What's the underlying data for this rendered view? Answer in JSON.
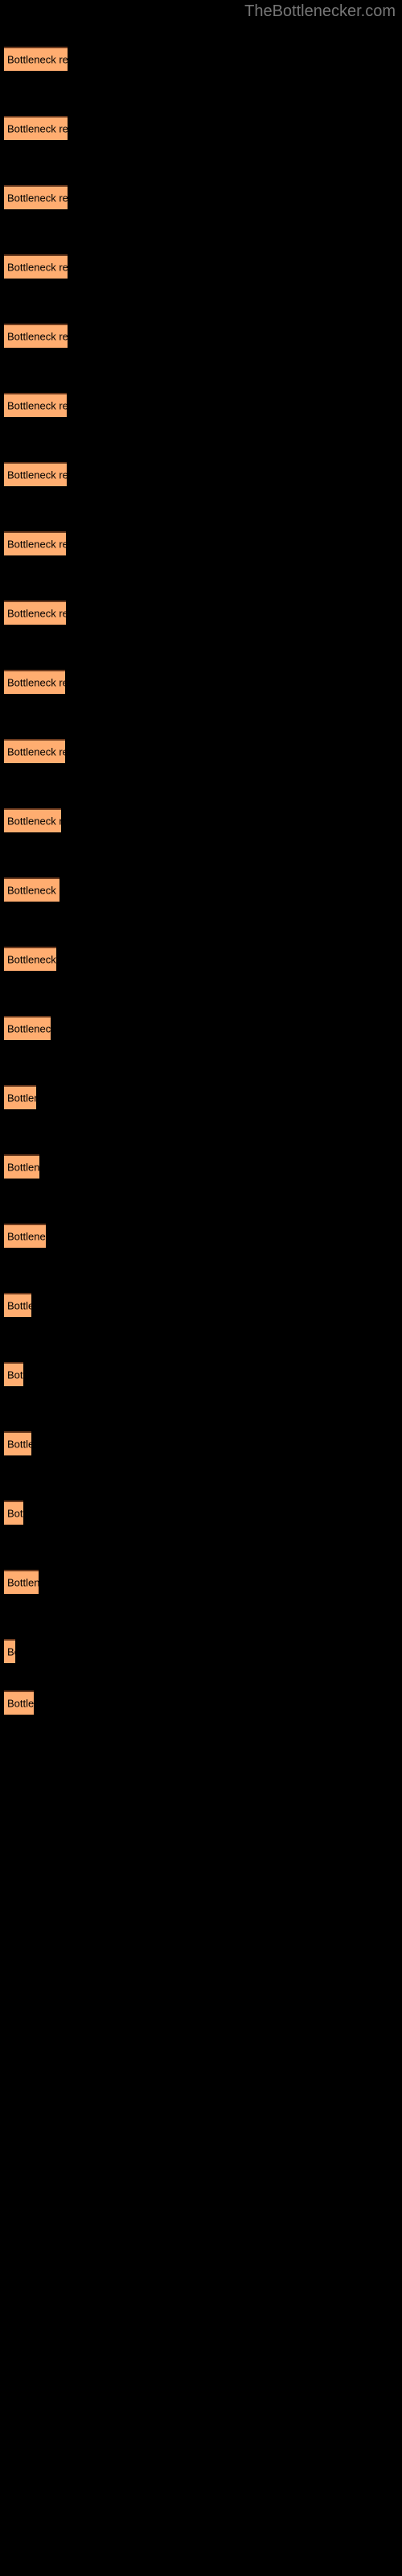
{
  "site": {
    "title": "TheBottlenecker.com",
    "title_color": "#767676"
  },
  "colors": {
    "background": "#000000",
    "bar_fill": "#ffad70",
    "bar_top_border": "#6b3a1e",
    "bar_text": "#000000"
  },
  "chart_data": {
    "type": "bar",
    "orientation": "horizontal",
    "title": "",
    "subtitle": "",
    "xlabel": "",
    "ylabel": "",
    "grid": false,
    "legend": null,
    "bar_label_text": "Bottleneck result",
    "categories": [
      "Bottleneck result",
      "Bottleneck result",
      "Bottleneck result",
      "Bottleneck result",
      "Bottleneck result",
      "Bottleneck result",
      "Bottleneck result",
      "Bottleneck result",
      "Bottleneck result",
      "Bottleneck result",
      "Bottleneck result",
      "Bottleneck result",
      "Bottleneck result",
      "Bottleneck result",
      "Bottleneck result",
      "Bottleneck result",
      "Bottleneck result",
      "Bottleneck result",
      "Bottleneck result",
      "Bottleneck result",
      "Bottleneck result",
      "Bottleneck result",
      "Bottleneck result",
      "Bottleneck result"
    ],
    "values": [
      79,
      79,
      79,
      79,
      79,
      79,
      79,
      79,
      79,
      79,
      79,
      74,
      70,
      66,
      61,
      46,
      45,
      41,
      34,
      28,
      33,
      26,
      44,
      16,
      38
    ],
    "xlim": [
      0,
      500
    ],
    "ylim": null
  },
  "bars": [
    {
      "label": "Bottleneck result",
      "width": 79,
      "top": 58
    },
    {
      "label": "Bottleneck result",
      "width": 79,
      "top": 144
    },
    {
      "label": "Bottleneck result",
      "width": 79,
      "top": 230
    },
    {
      "label": "Bottleneck result",
      "width": 79,
      "top": 316
    },
    {
      "label": "Bottleneck result",
      "width": 79,
      "top": 402
    },
    {
      "label": "Bottleneck result",
      "width": 78,
      "top": 488
    },
    {
      "label": "Bottleneck result",
      "width": 78,
      "top": 574
    },
    {
      "label": "Bottleneck result",
      "width": 77,
      "top": 660
    },
    {
      "label": "Bottleneck result",
      "width": 77,
      "top": 746
    },
    {
      "label": "Bottleneck result",
      "width": 76,
      "top": 832
    },
    {
      "label": "Bottleneck result",
      "width": 76,
      "top": 918
    },
    {
      "label": "Bottleneck result",
      "width": 71,
      "top": 1004
    },
    {
      "label": "Bottleneck result",
      "width": 69,
      "top": 1090
    },
    {
      "label": "Bottleneck result",
      "width": 65,
      "top": 1176
    },
    {
      "label": "Bottleneck result",
      "width": 58,
      "top": 1262
    },
    {
      "label": "Bottleneck result",
      "width": 40,
      "top": 1348
    },
    {
      "label": "Bottleneck result",
      "width": 44,
      "top": 1434
    },
    {
      "label": "Bottleneck result",
      "width": 52,
      "top": 1520
    },
    {
      "label": "Bottleneck result",
      "width": 34,
      "top": 1606
    },
    {
      "label": "Bottleneck result",
      "width": 24,
      "top": 1692
    },
    {
      "label": "Bottleneck result",
      "width": 34,
      "top": 1778
    },
    {
      "label": "Bottleneck result",
      "width": 24,
      "top": 1864
    },
    {
      "label": "Bottleneck result",
      "width": 43,
      "top": 1950
    },
    {
      "label": "Bottleneck result",
      "width": 14,
      "top": 2036
    },
    {
      "label": "Bottleneck result",
      "width": 37,
      "top": 2100
    }
  ]
}
